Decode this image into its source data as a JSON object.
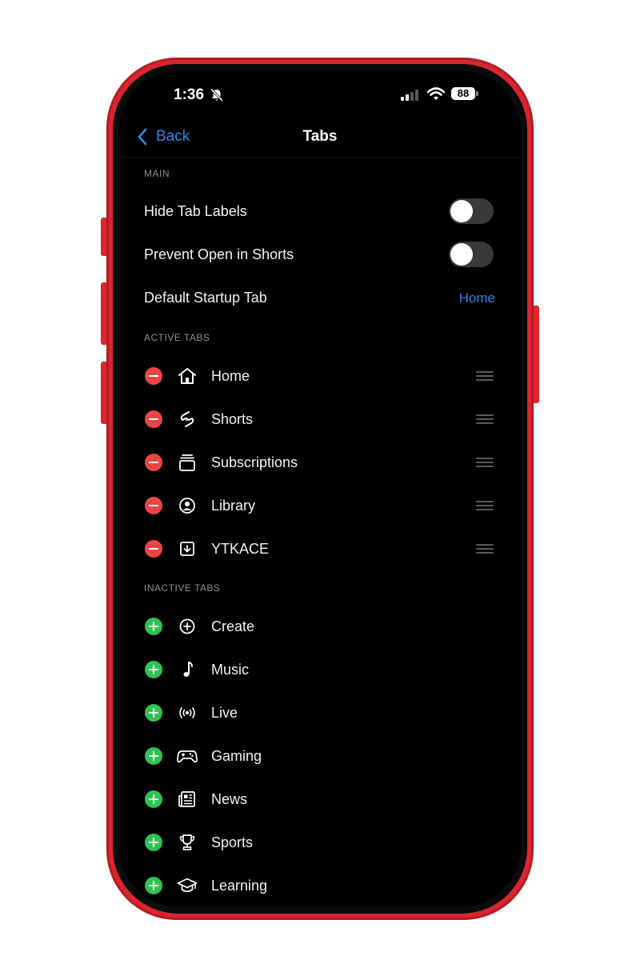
{
  "status_bar": {
    "time": "1:36",
    "battery": "88",
    "icons": [
      "bell-slash-icon",
      "cellular-signal-icon",
      "wifi-icon",
      "battery-icon"
    ]
  },
  "nav": {
    "back_label": "Back",
    "title": "Tabs"
  },
  "main_section": {
    "header": "MAIN",
    "items": [
      {
        "label": "Hide Tab Labels",
        "type": "toggle",
        "on": false
      },
      {
        "label": "Prevent Open in Shorts",
        "type": "toggle",
        "on": false
      },
      {
        "label": "Default Startup Tab",
        "type": "value",
        "value": "Home"
      }
    ]
  },
  "active_section": {
    "header": "ACTIVE TABS",
    "items": [
      {
        "label": "Home",
        "icon": "home-icon"
      },
      {
        "label": "Shorts",
        "icon": "shorts-icon"
      },
      {
        "label": "Subscriptions",
        "icon": "subscriptions-icon"
      },
      {
        "label": "Library",
        "icon": "library-icon"
      },
      {
        "label": "YTKACE",
        "icon": "download-icon"
      }
    ]
  },
  "inactive_section": {
    "header": "INACTIVE TABS",
    "items": [
      {
        "label": "Create",
        "icon": "create-icon"
      },
      {
        "label": "Music",
        "icon": "music-note-icon"
      },
      {
        "label": "Live",
        "icon": "live-broadcast-icon"
      },
      {
        "label": "Gaming",
        "icon": "gamepad-icon"
      },
      {
        "label": "News",
        "icon": "newspaper-icon"
      },
      {
        "label": "Sports",
        "icon": "trophy-icon"
      },
      {
        "label": "Learning",
        "icon": "graduation-cap-icon"
      }
    ]
  },
  "colors": {
    "frame": "#d9262f",
    "accent": "#2f86e6",
    "remove": "#eb4646",
    "add": "#2fc352"
  }
}
